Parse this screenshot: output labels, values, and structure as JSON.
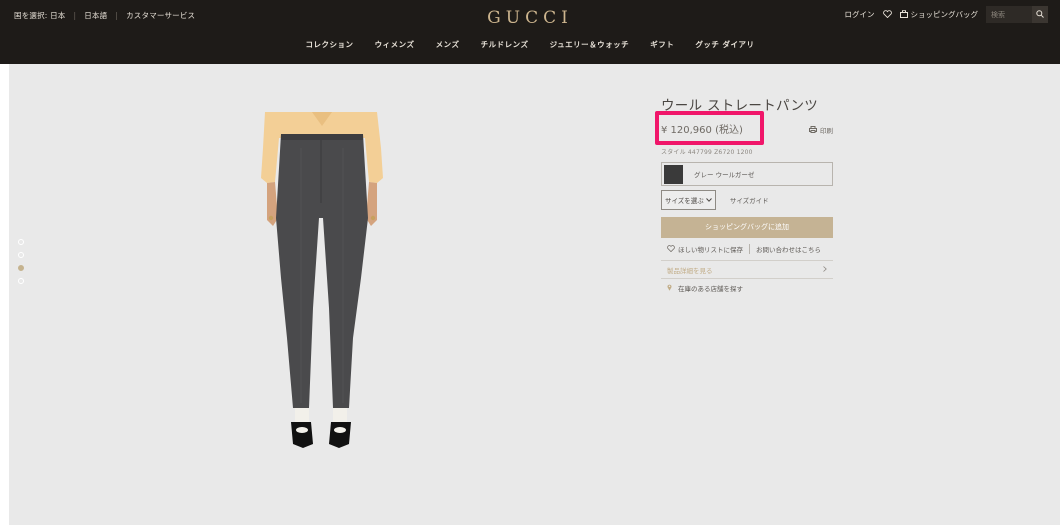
{
  "header": {
    "country_label": "国を選択: 日本",
    "language_label": "日本語",
    "customer_service_label": "カスタマーサービス",
    "logo_text": "GUCCI",
    "login_label": "ログイン",
    "bag_label": "ショッピングバッグ",
    "search_placeholder": "検索",
    "nav": [
      "コレクション",
      "ウィメンズ",
      "メンズ",
      "チルドレンズ",
      "ジュエリー＆ウォッチ",
      "ギフト",
      "グッチ ダイアリ"
    ]
  },
  "gallery": {
    "slide_count": 4,
    "active_slide": 3,
    "image_subject": "grey wool straight pants on model"
  },
  "product": {
    "title": "ウール ストレートパンツ",
    "price": "¥ 120,960 (税込)",
    "print_label": "印刷",
    "style_number": "スタイル 447799 Z6720 1200",
    "color_label": "グレー ウールガーゼ",
    "size_select_label": "サイズを選ぶ",
    "size_guide_label": "サイズガイド",
    "add_to_bag_label": "ショッピングバッグに追加",
    "wishlist_label": "ほしい物リストに保存",
    "contact_label": "お問い合わせはこちら",
    "details_label": "製品詳細を見る",
    "store_label": "在庫のある店舗を探す"
  },
  "colors": {
    "header_bg": "#1e1b18",
    "logo_gold": "#cdb58e",
    "add_button": "#c5b394",
    "highlight": "#f0166a",
    "stage_bg": "#e9e9e9",
    "swatch": "#3a3a3a"
  },
  "icons": [
    "heart-icon",
    "bag-icon",
    "search-icon",
    "printer-icon",
    "chevron-down-icon",
    "chevron-right-icon",
    "location-pin-icon"
  ]
}
